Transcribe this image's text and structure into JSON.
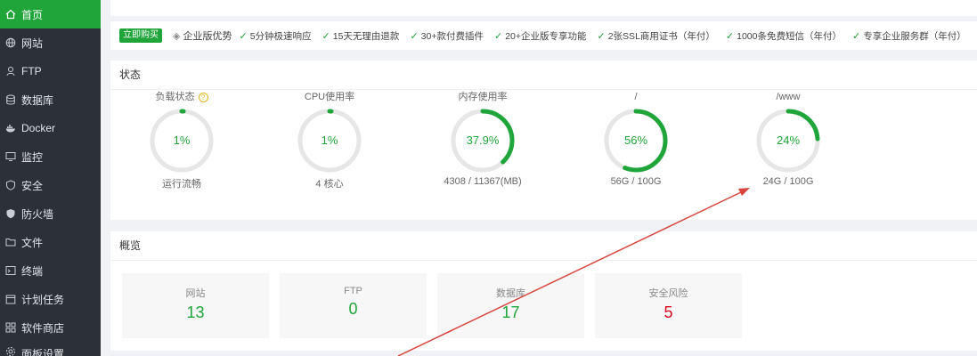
{
  "sidebar": {
    "items": [
      {
        "label": "首页",
        "icon": "home-icon",
        "active": true
      },
      {
        "label": "网站",
        "icon": "globe-icon"
      },
      {
        "label": "FTP",
        "icon": "ftp-icon"
      },
      {
        "label": "数据库",
        "icon": "database-icon"
      },
      {
        "label": "Docker",
        "icon": "docker-icon"
      },
      {
        "label": "监控",
        "icon": "monitor-icon"
      },
      {
        "label": "安全",
        "icon": "shield-icon"
      },
      {
        "label": "防火墙",
        "icon": "firewall-icon"
      },
      {
        "label": "文件",
        "icon": "folder-icon"
      },
      {
        "label": "终端",
        "icon": "terminal-icon"
      },
      {
        "label": "计划任务",
        "icon": "calendar-icon"
      },
      {
        "label": "软件商店",
        "icon": "apps-icon"
      },
      {
        "label": "面板设置",
        "icon": "settings-icon"
      }
    ]
  },
  "promo": {
    "buy_label": "立即购买",
    "title": "企业版优势",
    "features": [
      "5分钟极速响应",
      "15天无理由退款",
      "30+款付费插件",
      "20+企业版专享功能",
      "2张SSL商用证书（年付）",
      "1000条免费短信（年付）",
      "专享企业服务群（年付）"
    ]
  },
  "status": {
    "title": "状态",
    "gauges": [
      {
        "title": "负载状态",
        "value": "1%",
        "percent": 1,
        "sub": "运行流畅",
        "help": "?"
      },
      {
        "title": "CPU使用率",
        "value": "1%",
        "percent": 1,
        "sub": "4 核心"
      },
      {
        "title": "内存使用率",
        "value": "37.9%",
        "percent": 37.9,
        "sub": "4308 / 11367(MB)"
      },
      {
        "title": "/",
        "value": "56%",
        "percent": 56,
        "sub": "56G / 100G"
      },
      {
        "title": "/www",
        "value": "24%",
        "percent": 24,
        "sub": "24G / 100G"
      }
    ]
  },
  "overview": {
    "title": "概览",
    "stats": [
      {
        "label": "网站",
        "value": "13",
        "color": "#20a53a"
      },
      {
        "label": "FTP",
        "value": "0",
        "color": "#20a53a"
      },
      {
        "label": "数据库",
        "value": "17",
        "color": "#20a53a"
      },
      {
        "label": "安全风险",
        "value": "5",
        "color": "#d9001b"
      }
    ]
  },
  "colors": {
    "accent": "#20a53a",
    "track": "#e6e6e6",
    "arrow": "#d9443e"
  }
}
